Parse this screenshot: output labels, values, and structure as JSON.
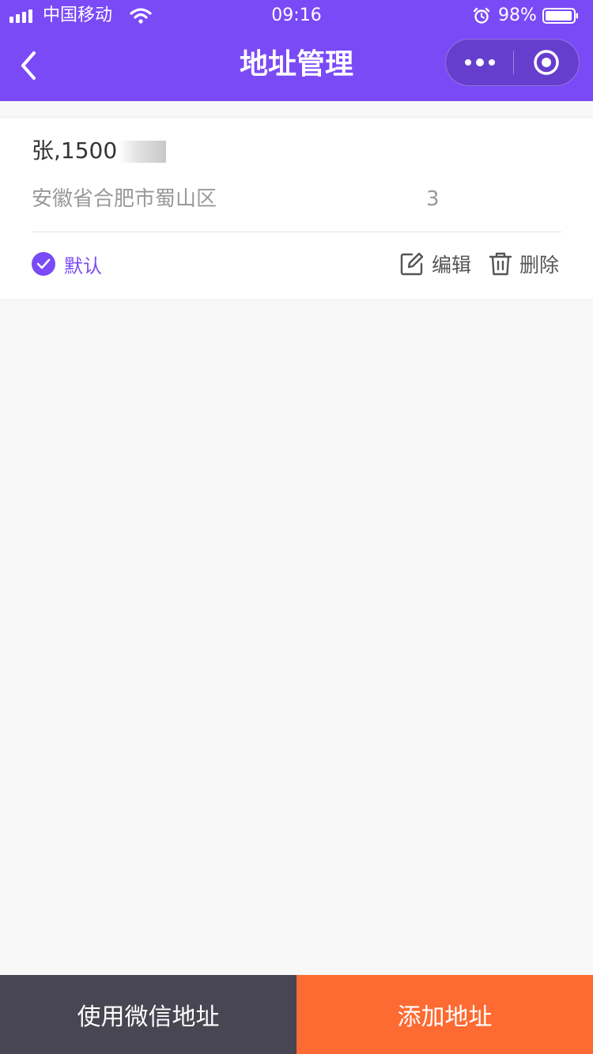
{
  "status_bar": {
    "carrier": "中国移动",
    "time": "09:16",
    "battery_percent": "98%",
    "icons": [
      "signal-icon",
      "wifi-icon",
      "alarm-icon",
      "battery-icon"
    ]
  },
  "nav": {
    "title": "地址管理",
    "icons": [
      "back-icon",
      "more-icon",
      "close-target-icon"
    ]
  },
  "address": {
    "contact_visible": "张,1500",
    "address_visible_start": "安徽省合肥市蜀山区",
    "address_visible_end": "3",
    "default_label": "默认",
    "edit_label": "编辑",
    "delete_label": "删除",
    "icons": [
      "check-circle-icon",
      "edit-icon",
      "trash-icon"
    ]
  },
  "bottom_bar": {
    "wechat_label": "使用微信地址",
    "add_label": "添加地址"
  },
  "colors": {
    "brand": "#7a4af6",
    "background": "#f8f8f8",
    "wechat_button": "#474652",
    "add_button": "#fd6a32"
  }
}
